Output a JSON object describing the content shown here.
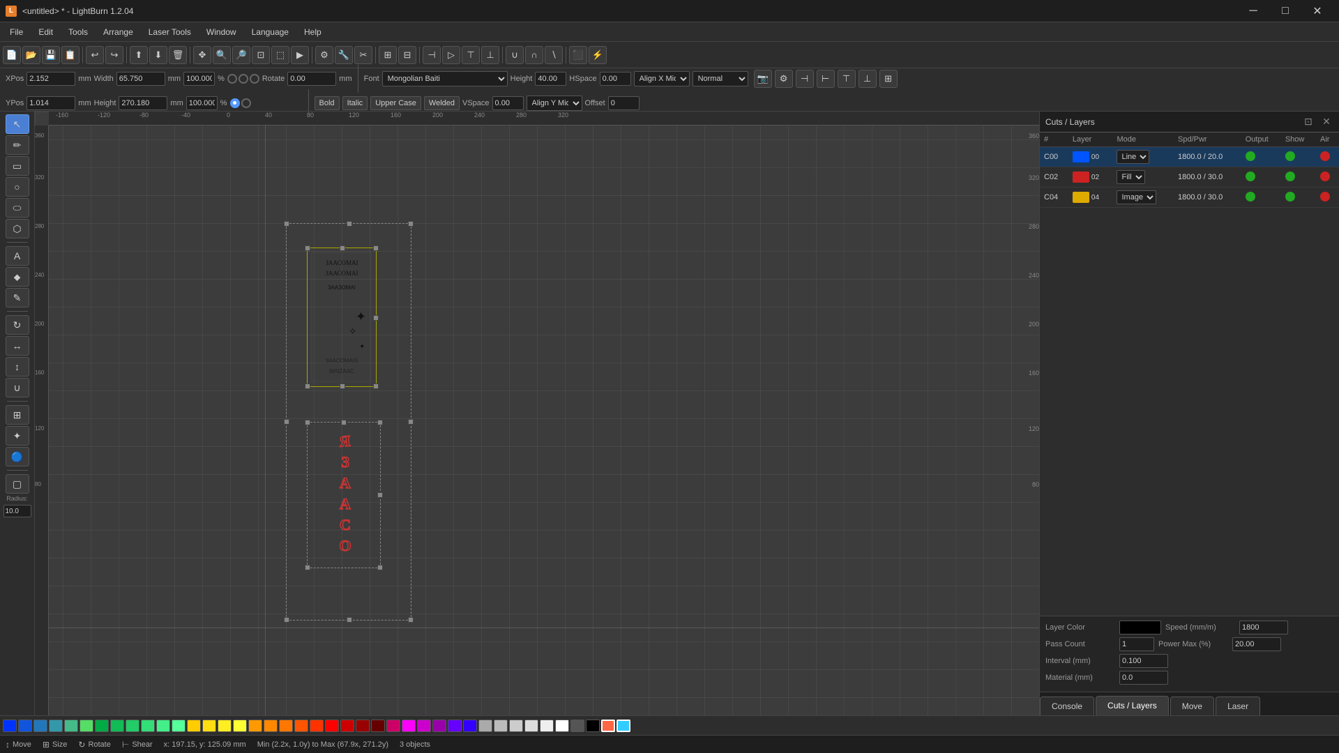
{
  "app": {
    "title": "<untitled> * - LightBurn 1.2.04"
  },
  "titlebar": {
    "icon": "LB",
    "title": "<untitled> * - LightBurn 1.2.04",
    "minimize": "─",
    "maximize": "□",
    "close": "✕"
  },
  "menu": {
    "items": [
      "File",
      "Edit",
      "Tools",
      "Arrange",
      "Laser Tools",
      "Window",
      "Language",
      "Help"
    ]
  },
  "propbar": {
    "xpos_label": "XPos",
    "xpos_value": "2.152",
    "ypos_label": "YPos",
    "ypos_value": "1.014",
    "width_label": "Width",
    "width_value": "65.750",
    "height_label": "Height",
    "height_value": "270.180",
    "w_pct": "100.000",
    "h_pct": "100.000",
    "mm": "mm",
    "rotate_label": "Rotate",
    "rotate_value": "0.00",
    "mm2": "mm",
    "font_label": "Font",
    "font_value": "Mongolian Baiti",
    "height2_label": "Height",
    "height2_value": "40.00",
    "hspace_label": "HSpace",
    "hspace_value": "0.00",
    "alignx_label": "Align X Middle",
    "aligny_label": "Align Y Middle",
    "normal_label": "Normal",
    "offset_label": "Offset",
    "offset_value": "0",
    "bold_label": "Bold",
    "italic_label": "Italic",
    "uppercase_label": "Upper Case",
    "welded_label": "Welded",
    "vspace_label": "VSpace",
    "vspace_value": "0.00"
  },
  "lefttool": {
    "tools": [
      {
        "name": "select-tool",
        "icon": "⬡",
        "label": ""
      },
      {
        "name": "draw-tool",
        "icon": "✏",
        "label": ""
      },
      {
        "name": "rect-tool",
        "icon": "▭",
        "label": ""
      },
      {
        "name": "circle-tool",
        "icon": "○",
        "label": ""
      },
      {
        "name": "ellipse-tool",
        "icon": "⬭",
        "label": ""
      },
      {
        "name": "polygon-tool",
        "icon": "⬡2",
        "label": ""
      },
      {
        "name": "text-tool",
        "icon": "A",
        "label": ""
      },
      {
        "name": "node-tool",
        "icon": "⬥",
        "label": ""
      },
      {
        "name": "edit-tool",
        "icon": "✎",
        "label": ""
      }
    ],
    "radius_label": "Radius:",
    "radius_value": "10.0"
  },
  "cuts_layers": {
    "title": "Cuts / Layers",
    "columns": [
      "#",
      "Layer",
      "Mode",
      "Spd/Pwr",
      "Output",
      "Show",
      "Air"
    ],
    "rows": [
      {
        "id": "C00",
        "color": "#0055ff",
        "color_label": "00",
        "mode": "Line",
        "spd_pwr": "1800.0 / 20.0",
        "output": true,
        "show": true,
        "air": true
      },
      {
        "id": "C02",
        "color": "#cc2222",
        "color_label": "02",
        "mode": "Fill",
        "spd_pwr": "1800.0 / 30.0",
        "output": true,
        "show": true,
        "air": true
      },
      {
        "id": "C04",
        "color": "#ddaa00",
        "color_label": "04",
        "mode": "Image",
        "spd_pwr": "1800.0 / 30.0",
        "output": true,
        "show": true,
        "air": true
      }
    ]
  },
  "layer_props": {
    "layer_color_label": "Layer Color",
    "speed_label": "Speed (mm/m)",
    "speed_value": "1800",
    "pass_count_label": "Pass Count",
    "pass_count_value": "1",
    "power_max_label": "Power Max (%)",
    "power_max_value": "20.00",
    "interval_label": "Interval (mm)",
    "interval_value": "0.100",
    "material_label": "Material (mm)",
    "material_value": "0.0"
  },
  "bottom_tabs": {
    "tabs": [
      "Console",
      "Cuts / Layers",
      "Move",
      "Laser"
    ]
  },
  "colorbar": {
    "colors": [
      "#0033ff",
      "#1155ff",
      "#2277ff",
      "#3399ff",
      "#44bbff",
      "#55ddff",
      "#00aa44",
      "#11bb55",
      "#22cc66",
      "#33dd77",
      "#44ee88",
      "#ffcc00",
      "#ffdd11",
      "#ffee22",
      "#ffff33",
      "#ff9900",
      "#ff8800",
      "#ff7700",
      "#ff6600",
      "#ff3300",
      "#ff0000",
      "#cc0000",
      "#990000",
      "#660000",
      "#cc0066",
      "#ff00ff",
      "#cc00cc",
      "#9900aa",
      "#6600ff",
      "#3300ff",
      "#aaaaaa",
      "#bbbbbb",
      "#cccccc",
      "#dddddd",
      "#eeeeee",
      "#ffffff",
      "#555555",
      "#000000"
    ]
  },
  "statusbar": {
    "move_label": "Move",
    "size_label": "Size",
    "rotate_label": "Rotate",
    "shear_label": "Shear",
    "coords": "x: 197.15, y: 125.09 mm",
    "bounds": "Min (2.2x, 1.0y) to Max (67.9x, 271.2y)",
    "objects": "3 objects"
  },
  "ruler": {
    "top_labels": [
      "-160",
      "-120",
      "-80",
      "-40",
      "0",
      "40",
      "80",
      "120",
      "160",
      "200",
      "240",
      "280",
      "320"
    ],
    "left_labels": [
      "360",
      "320",
      "280",
      "240",
      "200",
      "160",
      "120",
      "80"
    ]
  }
}
